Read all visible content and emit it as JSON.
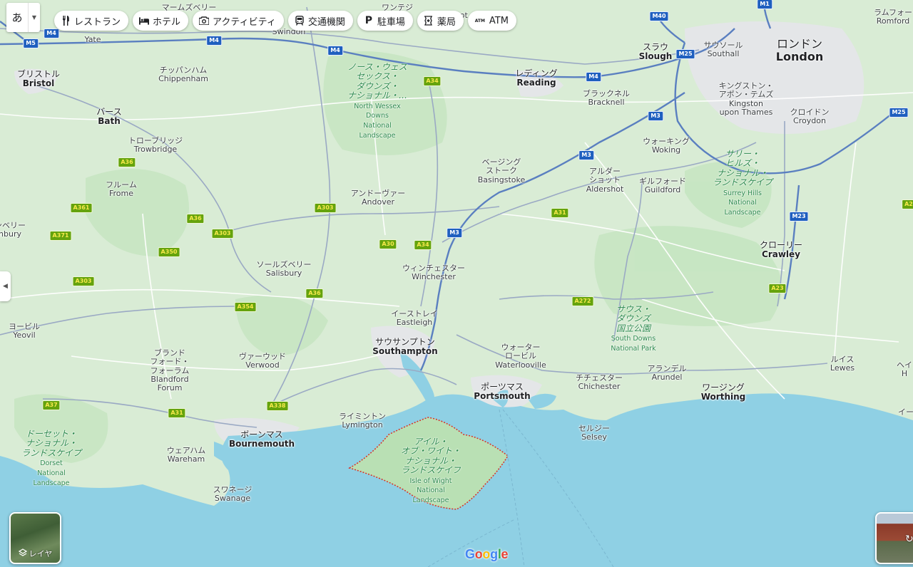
{
  "language_button": {
    "label": "あ"
  },
  "toolbar": {
    "chips": [
      {
        "label": "レストラン",
        "icon": "restaurant-icon"
      },
      {
        "label": "ホテル",
        "icon": "hotel-icon"
      },
      {
        "label": "アクティビティ",
        "icon": "camera-icon"
      },
      {
        "label": "交通機関",
        "icon": "transit-icon"
      },
      {
        "label": "駐車場",
        "icon": "parking-icon"
      },
      {
        "label": "薬局",
        "icon": "pharmacy-icon"
      },
      {
        "label": "ATM",
        "icon": "atm-icon"
      }
    ]
  },
  "layers": {
    "label": "レイヤ"
  },
  "logo": {
    "letters": [
      "G",
      "o",
      "o",
      "g",
      "l",
      "e"
    ],
    "colors": [
      "#4285F4",
      "#EA4335",
      "#FBBC05",
      "#4285F4",
      "#34A853",
      "#EA4335"
    ]
  },
  "colors": {
    "land": "#d9ecd5",
    "sea": "#8fd0e4",
    "park": "#b9e0b4",
    "island_border": "#d93025"
  },
  "places": {
    "marlborough": "マームズベリー",
    "wantage": "ワンテジ",
    "didcot": "Didcot",
    "swindon": "Swindon",
    "yate": "Yate",
    "bristol_ja": "ブリストル",
    "bristol_en": "Bristol",
    "chippenham_ja": "チッパンハム",
    "chippenham_en": "Chippenham",
    "bath_ja": "バース",
    "bath_en": "Bath",
    "trowbridge_ja": "トローブリッジ",
    "trowbridge_en": "Trowbridge",
    "frome_ja": "フルーム",
    "frome_en": "Frome",
    "nbury_ja": "ンベリー",
    "nbury_en": "nbury",
    "andover_ja": "アンドーヴァー",
    "andover_en": "Andover",
    "salisbury_ja": "ソールズベリー",
    "salisbury_en": "Salisbury",
    "winchester_ja": "ウィンチェスター",
    "winchester_en": "Winchester",
    "eastleigh_ja": "イーストレイ",
    "eastleigh_en": "Eastleigh",
    "southampton_ja": "サウサンプトン",
    "southampton_en": "Southampton",
    "verwood_ja": "ヴァーウッド",
    "verwood_en": "Verwood",
    "blandford_ja1": "ブランド",
    "blandford_ja2": "フォード・",
    "blandford_ja3": "フォーラム",
    "blandford_en1": "Blandford",
    "blandford_en2": "Forum",
    "yeovil_ja": "ヨービル",
    "yeovil_en": "Yeovil",
    "lymington_ja": "ライミントン",
    "lymington_en": "Lymington",
    "bournemouth_ja": "ボーンマス",
    "bournemouth_en": "Bournemouth",
    "wareham_ja": "ウェアハム",
    "wareham_en": "Wareham",
    "swanage_ja": "スワネージ",
    "swanage_en": "Swanage",
    "reading_ja": "レディング",
    "reading_en": "Reading",
    "bracknell_ja": "ブラックネル",
    "bracknell_en": "Bracknell",
    "basingstoke_ja1": "ベージング",
    "basingstoke_ja2": "ストーク",
    "basingstoke_en": "Basingstoke",
    "aldershot_ja1": "アルダー",
    "aldershot_ja2": "ショット",
    "aldershot_en": "Aldershot",
    "woking_ja": "ウォーキング",
    "woking_en": "Woking",
    "guildford_ja": "ギルフォード",
    "guildford_en": "Guildford",
    "slough_ja": "スラウ",
    "slough_en": "Slough",
    "southall_ja": "サウソール",
    "southall_en": "Southall",
    "london_ja": "ロンドン",
    "london_en": "London",
    "romford_ja": "ラムフォー",
    "romford_en": "Romford",
    "kingston_ja1": "キングストン・",
    "kingston_ja2": "アポン・テムズ",
    "kingston_en1": "Kingston",
    "kingston_en2": "upon Thames",
    "croydon_ja": "クロイドン",
    "croydon_en": "Croydon",
    "crawley_ja": "クローリー",
    "crawley_en": "Crawley",
    "waterlooville_ja1": "ウォーター",
    "waterlooville_ja2": "ロービル",
    "waterlooville_en": "Waterlooville",
    "portsmouth_ja": "ポーツマス",
    "portsmouth_en": "Portsmouth",
    "chichester_ja": "チチェスター",
    "chichester_en": "Chichester",
    "arundel_ja": "アランデル",
    "arundel_en": "Arundel",
    "worthing_ja": "ワージング",
    "worthing_en": "Worthing",
    "selsey_ja": "セルジー",
    "selsey_en": "Selsey",
    "lewes_ja": "ルイス",
    "lewes_en": "Lewes",
    "hei_ja": "ヘイ",
    "hei_en": "H",
    "ii_ja": "イー"
  },
  "parks": {
    "north_wessex_ja": [
      "ノース・ウェス",
      "セックス・",
      "ダウンズ・",
      "ナショナル・…"
    ],
    "north_wessex_en": [
      "North Wessex",
      "Downs",
      "National",
      "Landscape"
    ],
    "surrey_ja": [
      "サリー・",
      "ヒルズ・",
      "ナショナル・",
      "ランドスケイプ"
    ],
    "surrey_en": [
      "Surrey Hills",
      "National",
      "Landscape"
    ],
    "south_downs_ja": [
      "サウス・",
      "ダウンズ",
      "国立公園"
    ],
    "south_downs_en": [
      "South Downs",
      "National Park"
    ],
    "dorset_ja": [
      "ドーセット・",
      "ナショナル・",
      "ランドスケイプ"
    ],
    "dorset_en": [
      "Dorset",
      "National",
      "Landscape"
    ],
    "iow_ja": [
      "アイル・",
      "オブ・ワイト・",
      "ナショナル・",
      "ランドスケイフ"
    ],
    "iow_en": [
      "Isle of Wight",
      "National",
      "Landscape"
    ]
  },
  "roads": {
    "m4a": "M4",
    "m5": "M5",
    "m4b": "M4",
    "m4c": "M4",
    "m4d": "M4",
    "m40": "M40",
    "m1": "M1",
    "m25a": "M25",
    "m25b": "M25",
    "m3a": "M3",
    "m3b": "M3",
    "m3c": "M3",
    "m23": "M23",
    "a34a": "A34",
    "a34b": "A34",
    "a36a": "A36",
    "a36b": "A36",
    "a36c": "A36",
    "a361": "A361",
    "a371": "A371",
    "a303a": "A303",
    "a303b": "A303",
    "a303c": "A303",
    "a350": "A350",
    "a354": "A354",
    "a30": "A30",
    "a31a": "A31",
    "a31b": "A31",
    "a338": "A338",
    "a37": "A37",
    "a272": "A272",
    "a23": "A23",
    "a2x": "A2"
  }
}
